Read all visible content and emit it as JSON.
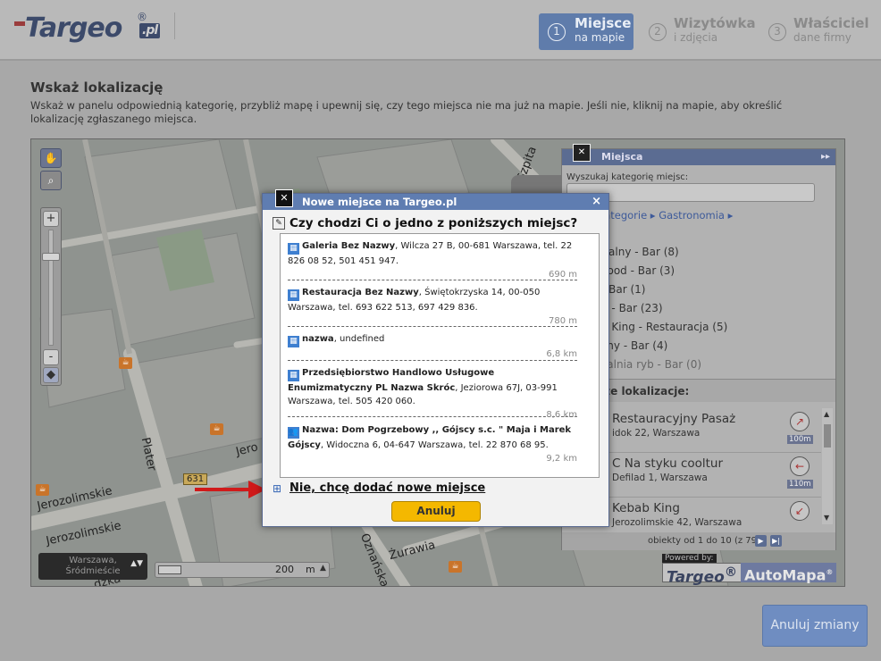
{
  "logo": {
    "text": "Targeo",
    "reg": "®",
    "suffix": ".pl"
  },
  "steps": [
    {
      "num": "1",
      "title": "Miejsce",
      "subtitle": "na mapie"
    },
    {
      "num": "2",
      "title": "Wizytówka",
      "subtitle": "i zdjęcia"
    },
    {
      "num": "3",
      "title": "Właściciel",
      "subtitle": "dane firmy"
    }
  ],
  "intro": {
    "title": "Wskaż lokalizację",
    "text": "Wskaż w panelu odpowiednią kategorię, przybliż mapę i upewnij się, czy tego miejsca nie ma już na mapie. Jeśli nie, kliknij na mapie, aby określić lokalizację zgłaszanego miejsca."
  },
  "map": {
    "streets": [
      "Jerozolimskie",
      "Jerozolimskie",
      "Plater",
      "Żurawia",
      "Oznańska",
      "Szpita",
      "Jero",
      "dzka"
    ],
    "road_badge": "631",
    "location": {
      "line1": "Warszawa,",
      "line2": "Śródmieście"
    },
    "scale": {
      "value": "200",
      "unit": "m"
    },
    "powered": {
      "label": "Powered by:",
      "brand1": "Targeo",
      "brand1_reg": "®",
      "brand2": "AutoMapa",
      "brand2_reg": "®"
    }
  },
  "places_panel": {
    "title": "Miejsca",
    "search_label": "Wyszukaj kategorię miejsc:",
    "breadcrumb": "e kategorie ▸ Gastronomia ▸",
    "categories": [
      "italny - Bar (8)",
      "Food - Bar (3)",
      "- Bar (1)",
      "b - Bar (23)",
      "b King - Restauracja (5)",
      "zny - Bar (4)",
      "zalnia ryb - Bar (0)"
    ],
    "results_header": "sze lokalizacje:",
    "results": [
      {
        "name": "Restauracyjny Pasaż",
        "address": "idok 22, Warszawa",
        "distance": "100m"
      },
      {
        "name": "C Na styku cooltur",
        "address": "Defilad 1, Warszawa",
        "distance": "110m"
      },
      {
        "name": "Kebab King",
        "address": "Jerozolimskie 42, Warszawa",
        "distance": ""
      }
    ],
    "pager": "obiekty od 1 do 10 (z 79)"
  },
  "dialog": {
    "title": "Nowe miejsce na Targeo.pl",
    "close": "×",
    "question": "Czy chodzi Ci o jedno z poniższych miejsc?",
    "items": [
      {
        "name": "Galeria Bez Nazwy",
        "details": ", Wilcza 27 B, 00-681 Warszawa, tel. 22 826 08 52, 501 451 947.",
        "distance": "690 m"
      },
      {
        "name": "Restauracja Bez Nazwy",
        "details": ", Świętokrzyska 14, 00-050 Warszawa, tel. 693 622 513, 697 429 836.",
        "distance": "780 m"
      },
      {
        "name": "nazwa",
        "details": ", undefined",
        "distance": "6,8 km"
      },
      {
        "name": "Przedsiębiorstwo Handlowo Usługowe Enumizmatyczny PL Nazwa Skróc",
        "details": ", Jeziorowa 67J, 03-991 Warszawa, tel. 505 420 060.",
        "distance": "8,6 km"
      },
      {
        "name": "Nazwa: Dom Pogrzebowy ,, Gójscy s.c. \" Maja i Marek Gójscy",
        "details": ", Widoczna 6, 04-647 Warszawa, tel. 22 870 68 95.",
        "distance": "9,2 km"
      }
    ],
    "add_new": "Nie, chcę dodać nowe miejsce",
    "cancel": "Anuluj"
  },
  "revert_button": "Anuluj zmiany",
  "colors": {
    "active_step": "#5f7cab",
    "cancel": "#f4b800",
    "dialog_header": "#5f7db1"
  }
}
